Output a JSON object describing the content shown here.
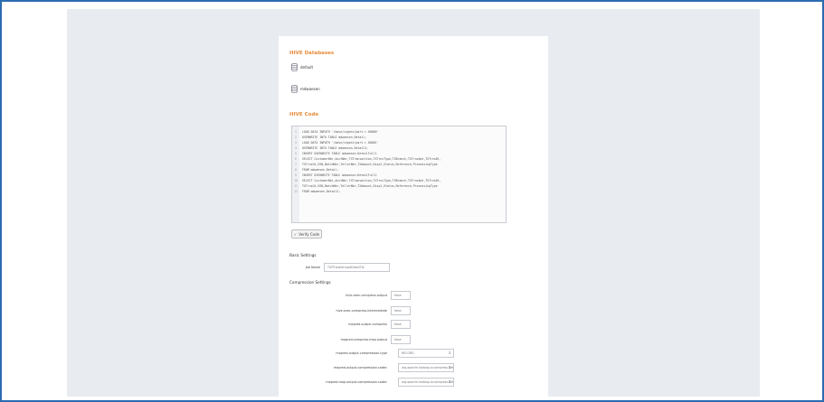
{
  "databases": {
    "title": "HIVE Databases",
    "items": [
      {
        "label": "default"
      },
      {
        "label": "mdwaesen"
      }
    ]
  },
  "code": {
    "title": "HIVE Code",
    "lines": [
      "LOAD DATA INPATH '/base/ingest/part-r-00000'",
      "    OVERWRITE INTO TABLE mdwaesen.Detail;",
      "LOAD DATA INPATH '/base/ingest/part-r-00001'",
      "    OVERWRITE INTO TABLE mdwaesen.Detail2;",
      "INSERT OVERWRITE TABLE mdwaesen.DetailFull1",
      "    SELECT CustomerNbr,AcctNbr,TXTransaction,TXTrnsType,TXBranch,TXTrnsAmt,TXTrnsDt,",
      "    TXTrnsCd,SSN,BatchNbr,TellerNbr,TXAmount,Disp1,Status,Reference,ProcessingType",
      "    FROM mdwaesen.Detail;",
      "INSERT OVERWRITE TABLE mdwaesen.DetailFull2",
      "    SELECT CustomerNbr,AcctNbr,TXTransaction,TXTrnsType,TXBranch,TXTrnsAmt,TXTrnsDt,",
      "    TXTrnsCd,SSN,BatchNbr,TellerNbr,TXAmount,Disp1,Status,Reference,ProcessingType",
      "    FROM mdwaesen.Detail2;"
    ],
    "verify_label": "Verify Code"
  },
  "basic_settings": {
    "title": "Basic Settings",
    "job_name_label": "Job Name",
    "job_name_value": "TXFTransferLoadDetailTbl"
  },
  "compression": {
    "title": "Compression Settings",
    "fields": [
      {
        "label": "hive.exec.compress.output",
        "value": "false"
      },
      {
        "label": "hive.exec.compress.intermediate",
        "value": "false"
      },
      {
        "label": "mapred.output.compress",
        "value": "false"
      },
      {
        "label": "mapred.compress.map.output",
        "value": "false"
      },
      {
        "label": "mapred.output.compression.type",
        "value": "RECORD"
      },
      {
        "label": "mapred.output.compression.codec",
        "value": "org.apache.hadoop.io.compress.DefaultCodec"
      },
      {
        "label": "mapred.map.output.compression.codec",
        "value": "org.apache.hadoop.io.compress.DefaultCodec"
      }
    ]
  },
  "colors": {
    "accent": "#e88b3a",
    "frame": "#2b6cb0",
    "backdrop": "#e8ebf0"
  }
}
